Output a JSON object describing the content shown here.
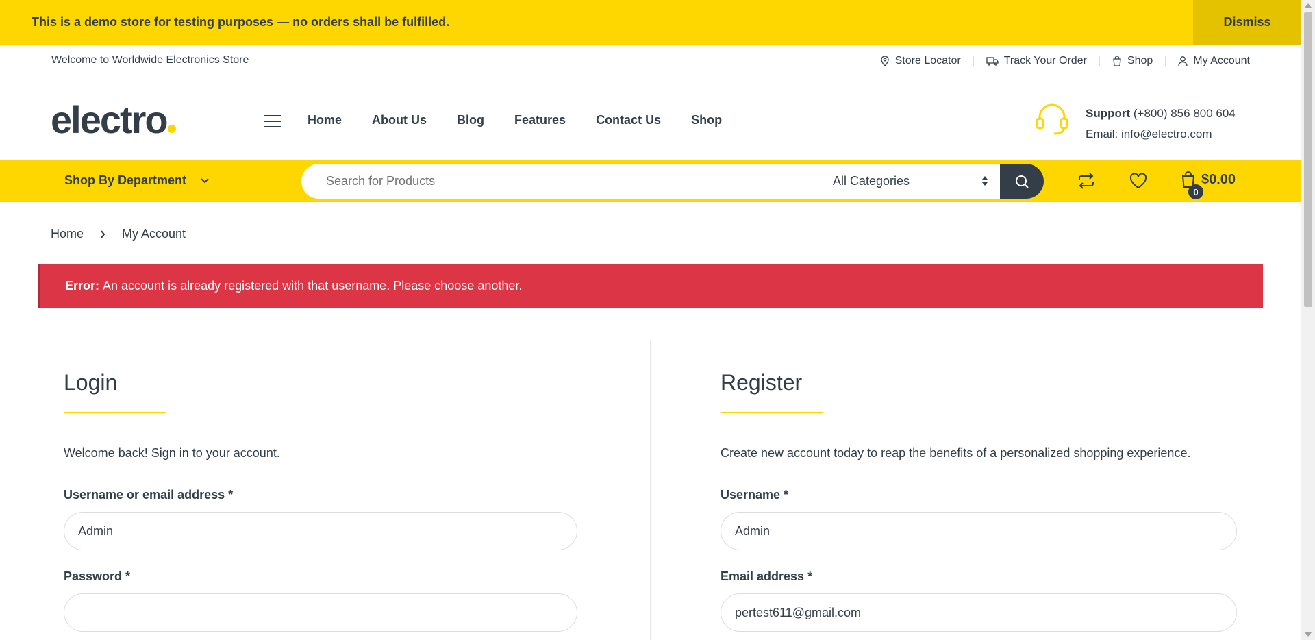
{
  "demo_notice": {
    "text": "This is a demo store for testing purposes — no orders shall be fulfilled.",
    "dismiss_label": "Dismiss"
  },
  "topbar": {
    "welcome": "Welcome to Worldwide Electronics Store",
    "links": [
      {
        "label": "Store Locator",
        "icon": "map-pin-icon"
      },
      {
        "label": "Track Your Order",
        "icon": "truck-icon"
      },
      {
        "label": "Shop",
        "icon": "shopping-bag-icon"
      },
      {
        "label": "My Account",
        "icon": "user-icon"
      }
    ]
  },
  "header": {
    "logo": "electro",
    "nav": [
      "Home",
      "About Us",
      "Blog",
      "Features",
      "Contact Us",
      "Shop"
    ],
    "support_label": "Support",
    "support_phone": "(+800) 856 800 604",
    "support_email": "Email: info@electro.com"
  },
  "search_bar": {
    "department_label": "Shop By Department",
    "placeholder": "Search for Products",
    "category_selected": "All Categories",
    "cart_count": "0",
    "cart_total": "$0.00"
  },
  "breadcrumb": {
    "home": "Home",
    "current": "My Account"
  },
  "error": {
    "prefix": "Error:",
    "message": "An account is already registered with that username. Please choose another."
  },
  "login": {
    "title": "Login",
    "description": "Welcome back! Sign in to your account.",
    "username_label": "Username or email address *",
    "username_value": "Admin",
    "password_label": "Password *",
    "password_value": ""
  },
  "register": {
    "title": "Register",
    "description": "Create new account today to reap the benefits of a personalized shopping experience.",
    "username_label": "Username *",
    "username_value": "Admin",
    "email_label": "Email address *",
    "email_value": "pertest611@gmail.com"
  },
  "colors": {
    "accent": "#fed700",
    "text": "#333e48",
    "error": "#dc3545"
  }
}
